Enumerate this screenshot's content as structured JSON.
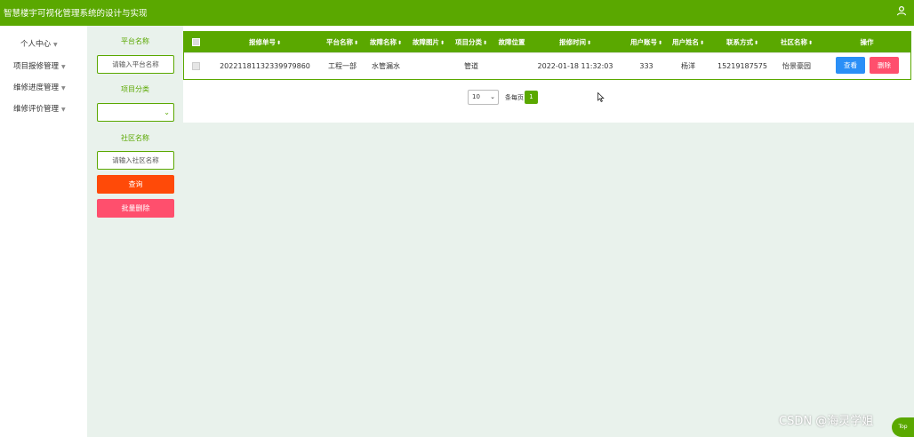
{
  "app": {
    "title": "智慧楼宇可视化管理系统的设计与实现"
  },
  "sidebar": {
    "items": [
      {
        "label": "个人中心"
      },
      {
        "label": "项目报修管理"
      },
      {
        "label": "维修进度管理"
      },
      {
        "label": "维修评价管理"
      }
    ]
  },
  "filter": {
    "platform_label": "平台名称",
    "platform_placeholder": "请输入平台名称",
    "category_label": "项目分类",
    "category_value": "",
    "community_label": "社区名称",
    "community_placeholder": "请输入社区名称",
    "query_label": "查询",
    "batch_delete_label": "批量删除"
  },
  "table": {
    "columns": [
      "报修单号",
      "平台名称",
      "故障名称",
      "故障图片",
      "项目分类",
      "故障位置",
      "报修时间",
      "用户账号",
      "用户姓名",
      "联系方式",
      "社区名称",
      "操作"
    ],
    "rows": [
      {
        "order_no": "20221181132339979860",
        "platform": "工程一部",
        "fault_name": "水管漏水",
        "fault_image": "",
        "category": "管道",
        "location": "",
        "report_time": "2022-01-18 11:32:03",
        "account": "333",
        "user_name": "杨洋",
        "contact": "15219187575",
        "community": "怡景豪园",
        "view_label": "查看",
        "delete_label": "删除"
      }
    ]
  },
  "pagination": {
    "page_size": "10",
    "per_page_label": "条每页",
    "current_page": "1"
  },
  "watermark": "CSDN @海灵学姐",
  "totop_label": "Top",
  "colors": {
    "brand": "#5aa800",
    "query": "#ff4a08",
    "danger": "#ff4f6d",
    "view": "#2a8ff7"
  }
}
